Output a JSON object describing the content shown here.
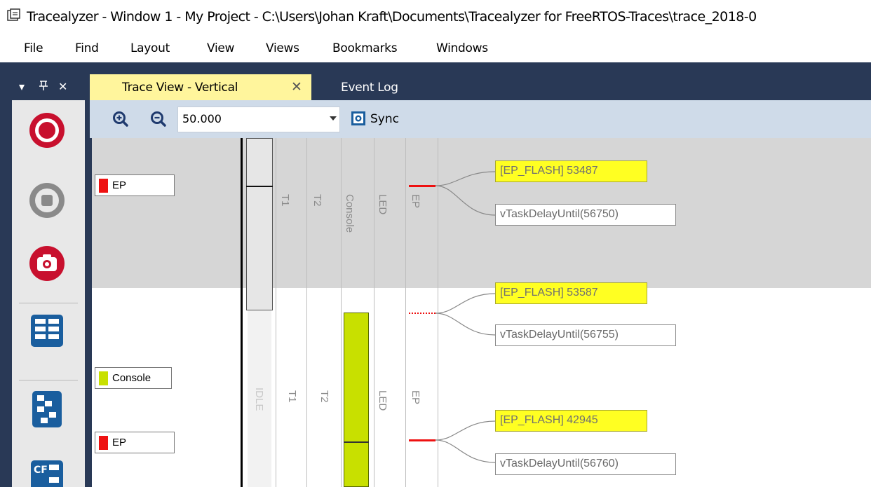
{
  "window": {
    "title": "Tracealyzer - Window 1 - My Project - C:\\Users\\Johan Kraft\\Documents\\Tracealyzer for FreeRTOS-Traces\\trace_2018-0"
  },
  "menu": {
    "items": [
      "File",
      "Find",
      "Layout",
      "View",
      "Views",
      "Bookmarks",
      "Windows"
    ]
  },
  "toolpanel": {
    "controls": [
      "▾",
      "ᵖ",
      "✕"
    ],
    "tools": [
      "record-icon",
      "stop-icon",
      "snapshot-icon",
      "dashboard-icon",
      "trace-view-icon",
      "cf-icon"
    ]
  },
  "tabs": [
    {
      "label": "Trace View - Vertical",
      "active": true,
      "close": "✕"
    },
    {
      "label": "Event Log",
      "active": false
    }
  ],
  "toolbar": {
    "zoom_in": "zoom-in-icon",
    "zoom_out": "zoom-out-icon",
    "zoom_value": "50.000",
    "sync_label": "Sync"
  },
  "trace": {
    "actor_labels": [
      {
        "text": "EP",
        "color": "#ee1111"
      },
      {
        "text": "Console",
        "color": "#c8e000"
      },
      {
        "text": "EP",
        "color": "#ee1111"
      }
    ],
    "lanes_top": [
      "T1",
      "T2",
      "Console",
      "LED",
      "EP"
    ],
    "lanes_bottom": [
      "IDLE",
      "T1",
      "T2",
      "LED",
      "EP"
    ],
    "events": [
      {
        "flash": "[EP_FLASH] 53487",
        "delay": "vTaskDelayUntil(56750)"
      },
      {
        "flash": "[EP_FLASH] 53587",
        "delay": "vTaskDelayUntil(56755)"
      },
      {
        "flash": "[EP_FLASH] 42945",
        "delay": "vTaskDelayUntil(56760)"
      }
    ],
    "colors": {
      "ep": "#ee1111",
      "console": "#c8e000",
      "flash_bg": "#ffff22",
      "frame": "#293956"
    }
  }
}
